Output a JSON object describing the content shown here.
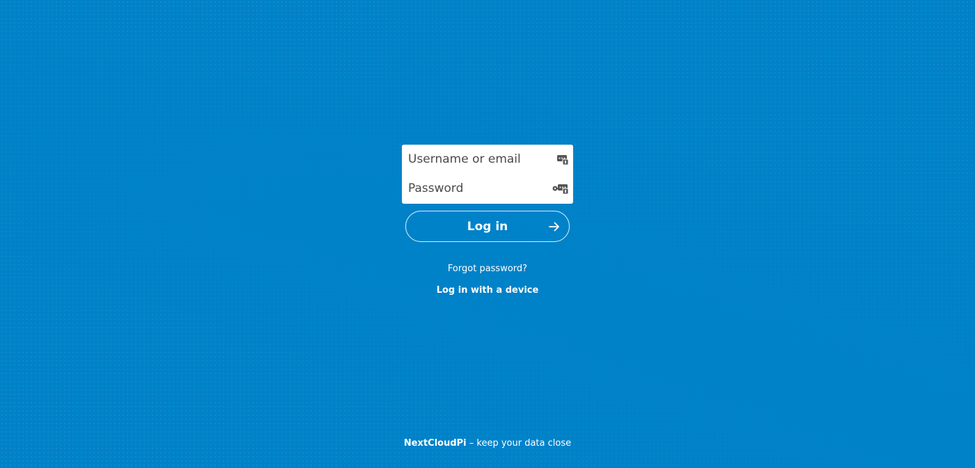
{
  "login": {
    "username_placeholder": "Username or email",
    "password_placeholder": "Password",
    "submit_label": "Log in",
    "forgot_password_label": "Forgot password?",
    "device_login_label": "Log in with a device"
  },
  "footer": {
    "brand": "NextCloudPi",
    "tagline": " – keep your data close"
  },
  "icons": {
    "username_field": "password-manager-icon",
    "password_field": "key-password-manager-icon",
    "submit": "arrow-right-icon"
  },
  "colors": {
    "background": "#0082c9",
    "text": "#ffffff",
    "field_background": "#ffffff"
  }
}
